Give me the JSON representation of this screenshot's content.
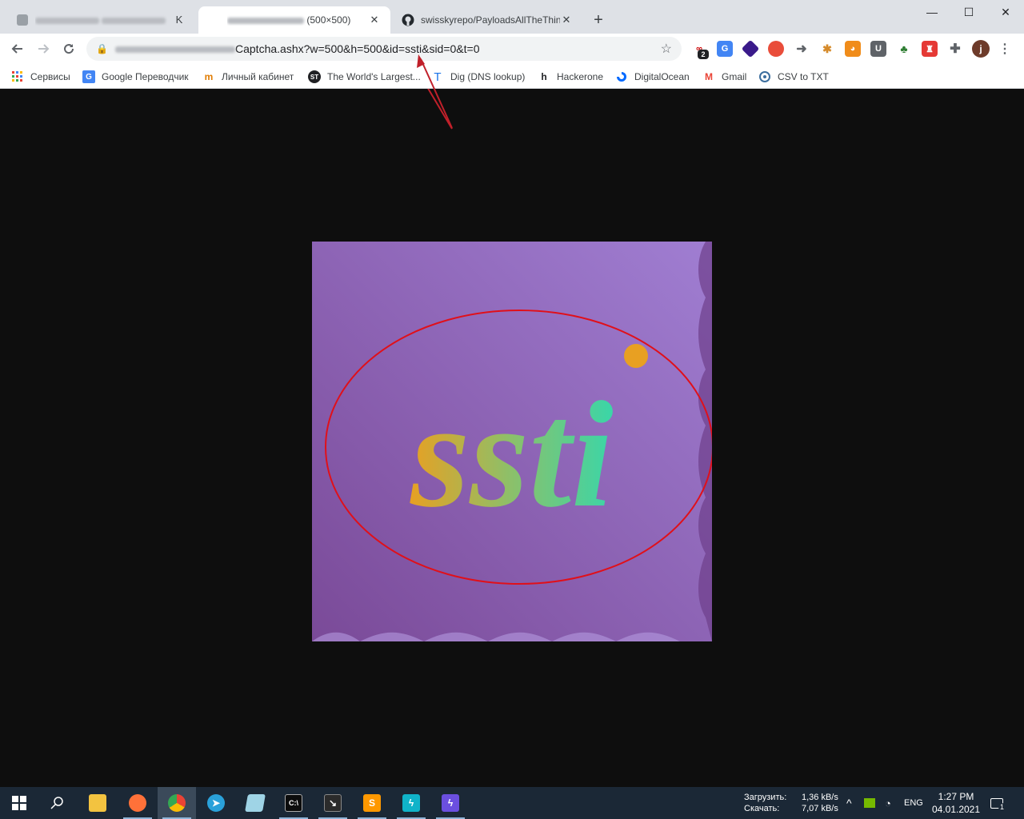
{
  "browser": {
    "tabs": [
      {
        "label": "",
        "active": false
      },
      {
        "label": "(500×500)",
        "active": true
      },
      {
        "label": "swisskyrepo/PayloadsAllTheThing",
        "active": false
      }
    ],
    "new_tab": "+",
    "window_controls": {
      "minimize": "—",
      "maximize": "☐",
      "close": "✕"
    },
    "address": {
      "path": "Captcha.ashx?w=500&h=500&id=ssti&sid=0&t=0"
    },
    "profile_initial": "j",
    "extension_badge": "2"
  },
  "bookmarks": [
    {
      "label": "Сервисы"
    },
    {
      "label": "Google Переводчик"
    },
    {
      "label": "Личный кабинет"
    },
    {
      "label": "The World's Largest..."
    },
    {
      "label": "Dig (DNS lookup)"
    },
    {
      "label": "Hackerone"
    },
    {
      "label": "DigitalOcean"
    },
    {
      "label": "Gmail"
    },
    {
      "label": "CSV to TXT"
    }
  ],
  "captcha": {
    "text": "ssti",
    "background_color": "#8b5fb0",
    "annotation_color": "#e0101a"
  },
  "taskbar": {
    "network": {
      "upload_label": "Загрузить:",
      "download_label": "Скачать:",
      "upload_value": "1,36 kB/s",
      "download_value": "7,07 kB/s"
    },
    "language": "ENG",
    "time": "1:27 PM",
    "date": "04.01.2021",
    "notification_count": "1"
  }
}
